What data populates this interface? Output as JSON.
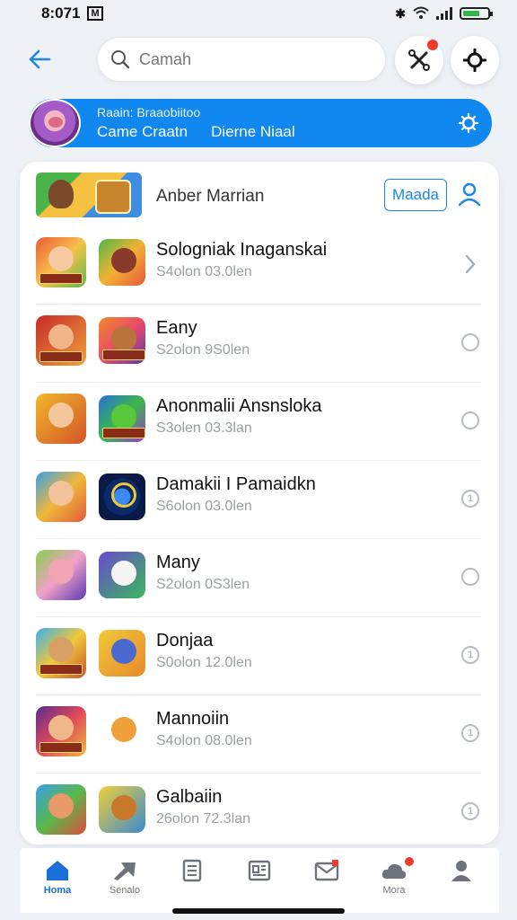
{
  "status_bar": {
    "time": "8:071",
    "carrier_badge": "M"
  },
  "search": {
    "placeholder": "Camah"
  },
  "banner": {
    "small_text": "Raain: Braaobiitoo",
    "link_1": "Came Craatn",
    "link_2": "Dierne Niaal"
  },
  "list_header": {
    "title": "Anber Marrian",
    "button_label": "Maada"
  },
  "rows": [
    {
      "title": "Sologniak Inaganskai",
      "subtitle": "S4olon 03.0len",
      "action": "chevron"
    },
    {
      "title": "Eany",
      "subtitle": "S2olon 9S0len",
      "action": "radio"
    },
    {
      "title": "Anonmalii Ansnsloka",
      "subtitle": "S3olen 03.3lan",
      "action": "radio"
    },
    {
      "title": "Damakii I Pamaidkn",
      "subtitle": "S6olon 03.0len",
      "action": "info"
    },
    {
      "title": "Many",
      "subtitle": "S2olon 0S3len",
      "action": "radio"
    },
    {
      "title": "Donjaa",
      "subtitle": "S0olon 12.0len",
      "action": "info"
    },
    {
      "title": "Mannoiin",
      "subtitle": "S4olon 08.0len",
      "action": "info"
    },
    {
      "title": "Galbaiin",
      "subtitle": "26olon 72.3lan",
      "action": "info"
    }
  ],
  "bottom_nav": {
    "items": [
      {
        "label": "Homa",
        "active": true
      },
      {
        "label": "Senalo",
        "active": false
      },
      {
        "label": "",
        "active": false
      },
      {
        "label": "",
        "active": false
      },
      {
        "label": "",
        "active": false
      },
      {
        "label": "Mora",
        "active": false
      },
      {
        "label": "",
        "active": false
      }
    ]
  },
  "colors": {
    "accent": "#1188f0",
    "badge_red": "#f03a2e",
    "active_nav": "#1a6fd8"
  },
  "icons": [
    "back-arrow-icon",
    "search-icon",
    "tools-icon",
    "settings-icon",
    "gear-icon",
    "user-icon",
    "chevron-right-icon",
    "radio-icon",
    "info-icon",
    "home-icon",
    "send-icon",
    "book-icon",
    "newspaper-icon",
    "mail-icon",
    "cloud-icon",
    "profile-icon"
  ]
}
